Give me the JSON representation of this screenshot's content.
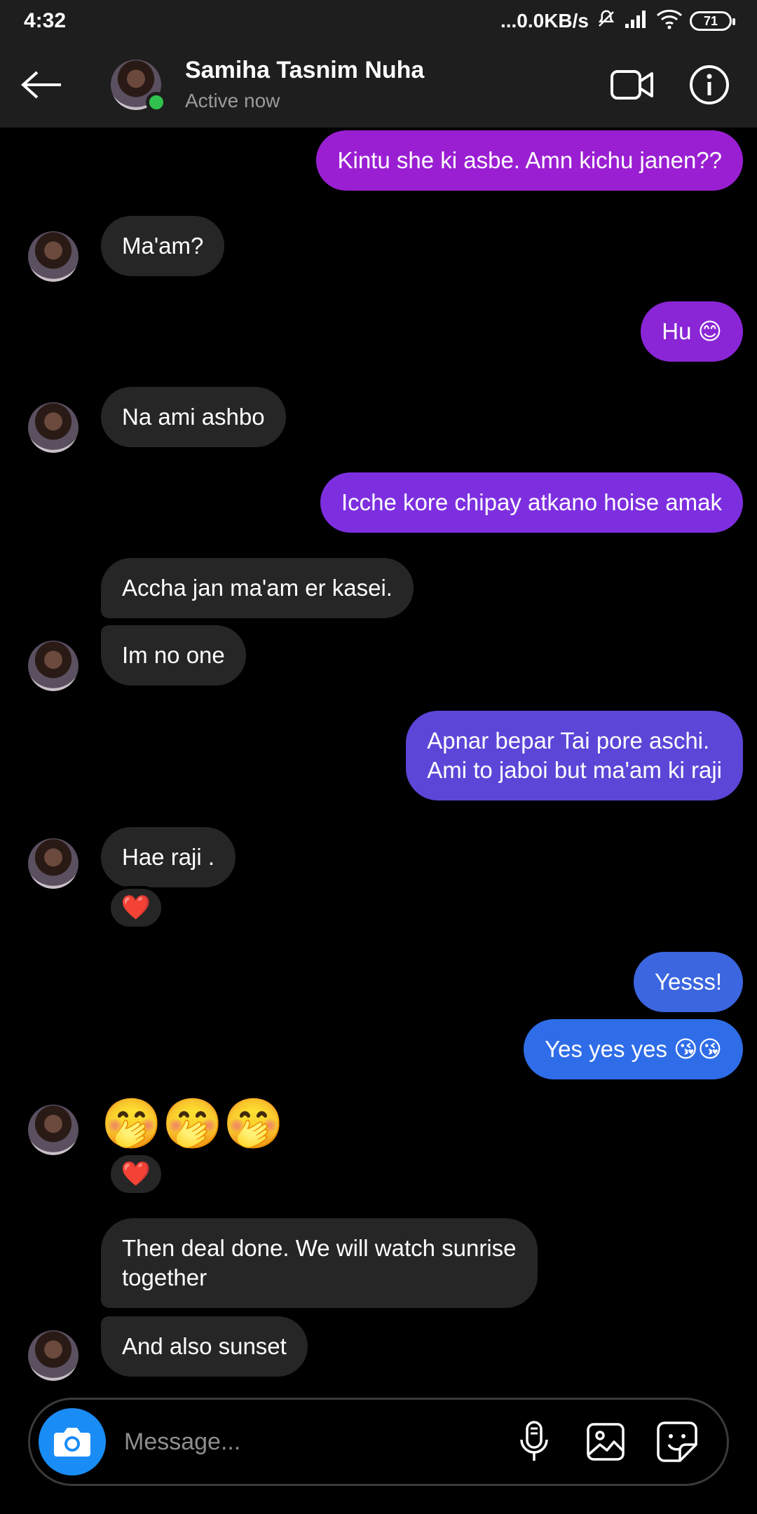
{
  "status_bar": {
    "time": "4:32",
    "network_speed": "...0.0KB/s",
    "battery": "71"
  },
  "header": {
    "contact_name": "Samiha Tasnim Nuha",
    "status": "Active now"
  },
  "messages": [
    {
      "text": "Kintu she ki asbe. Amn kichu janen??"
    },
    {
      "text": "Ma'am?"
    },
    {
      "text": "Hu 😊"
    },
    {
      "text": "Na ami ashbo"
    },
    {
      "text": "Icche kore chipay atkano hoise amak"
    },
    {
      "text": "Accha jan ma'am er kasei."
    },
    {
      "text": "Im no one"
    },
    {
      "line1": "Apnar bepar Tai pore aschi.",
      "line2": "Ami to jaboi but ma'am ki raji"
    },
    {
      "text": "Hae raji ."
    },
    {
      "text": "Yesss!"
    },
    {
      "text": "Yes yes yes 😘😘"
    },
    {
      "text": "🤭🤭🤭"
    },
    {
      "line1": "Then deal done. We will watch sunrise",
      "line2": "together"
    },
    {
      "text": "And also sunset"
    }
  ],
  "reactions": [
    "❤️",
    "❤️"
  ],
  "composer": {
    "placeholder": "Message..."
  }
}
